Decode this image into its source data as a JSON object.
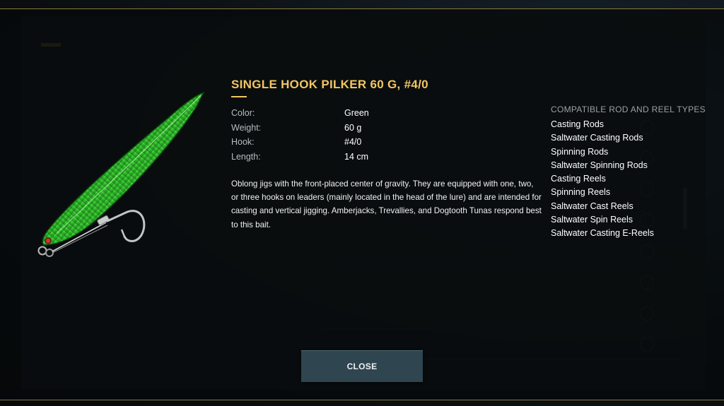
{
  "dialog": {
    "title": "SINGLE HOOK PILKER 60 G, #4/0",
    "specs": [
      {
        "label": "Color:",
        "value": "Green"
      },
      {
        "label": "Weight:",
        "value": "60 g"
      },
      {
        "label": "Hook:",
        "value": "#4/0"
      },
      {
        "label": "Length:",
        "value": "14 cm"
      }
    ],
    "description": "Oblong jigs with the front-placed center of gravity. They are equipped with one, two, or three hooks on leaders (mainly located in the head of the lure) and are intended for casting and vertical jigging. Amberjacks, Trevallies, and Dogtooth Tunas respond best to this bait.",
    "compatible": {
      "heading": "COMPATIBLE ROD AND REEL TYPES",
      "items": [
        "Casting Rods",
        "Saltwater Casting Rods",
        "Spinning Rods",
        "Saltwater Spinning Rods",
        "Casting Reels",
        "Spinning Reels",
        "Saltwater Cast Reels",
        "Saltwater Spin Reels",
        "Saltwater Casting E-Reels"
      ]
    },
    "close_label": "CLOSE",
    "lure_icon": "green-pilker-lure-image"
  },
  "colors": {
    "title": "#f2c662",
    "accent_line": "#8b7a3a",
    "button_bg": "#2f4650",
    "lure_green": "#2fbf2a"
  }
}
